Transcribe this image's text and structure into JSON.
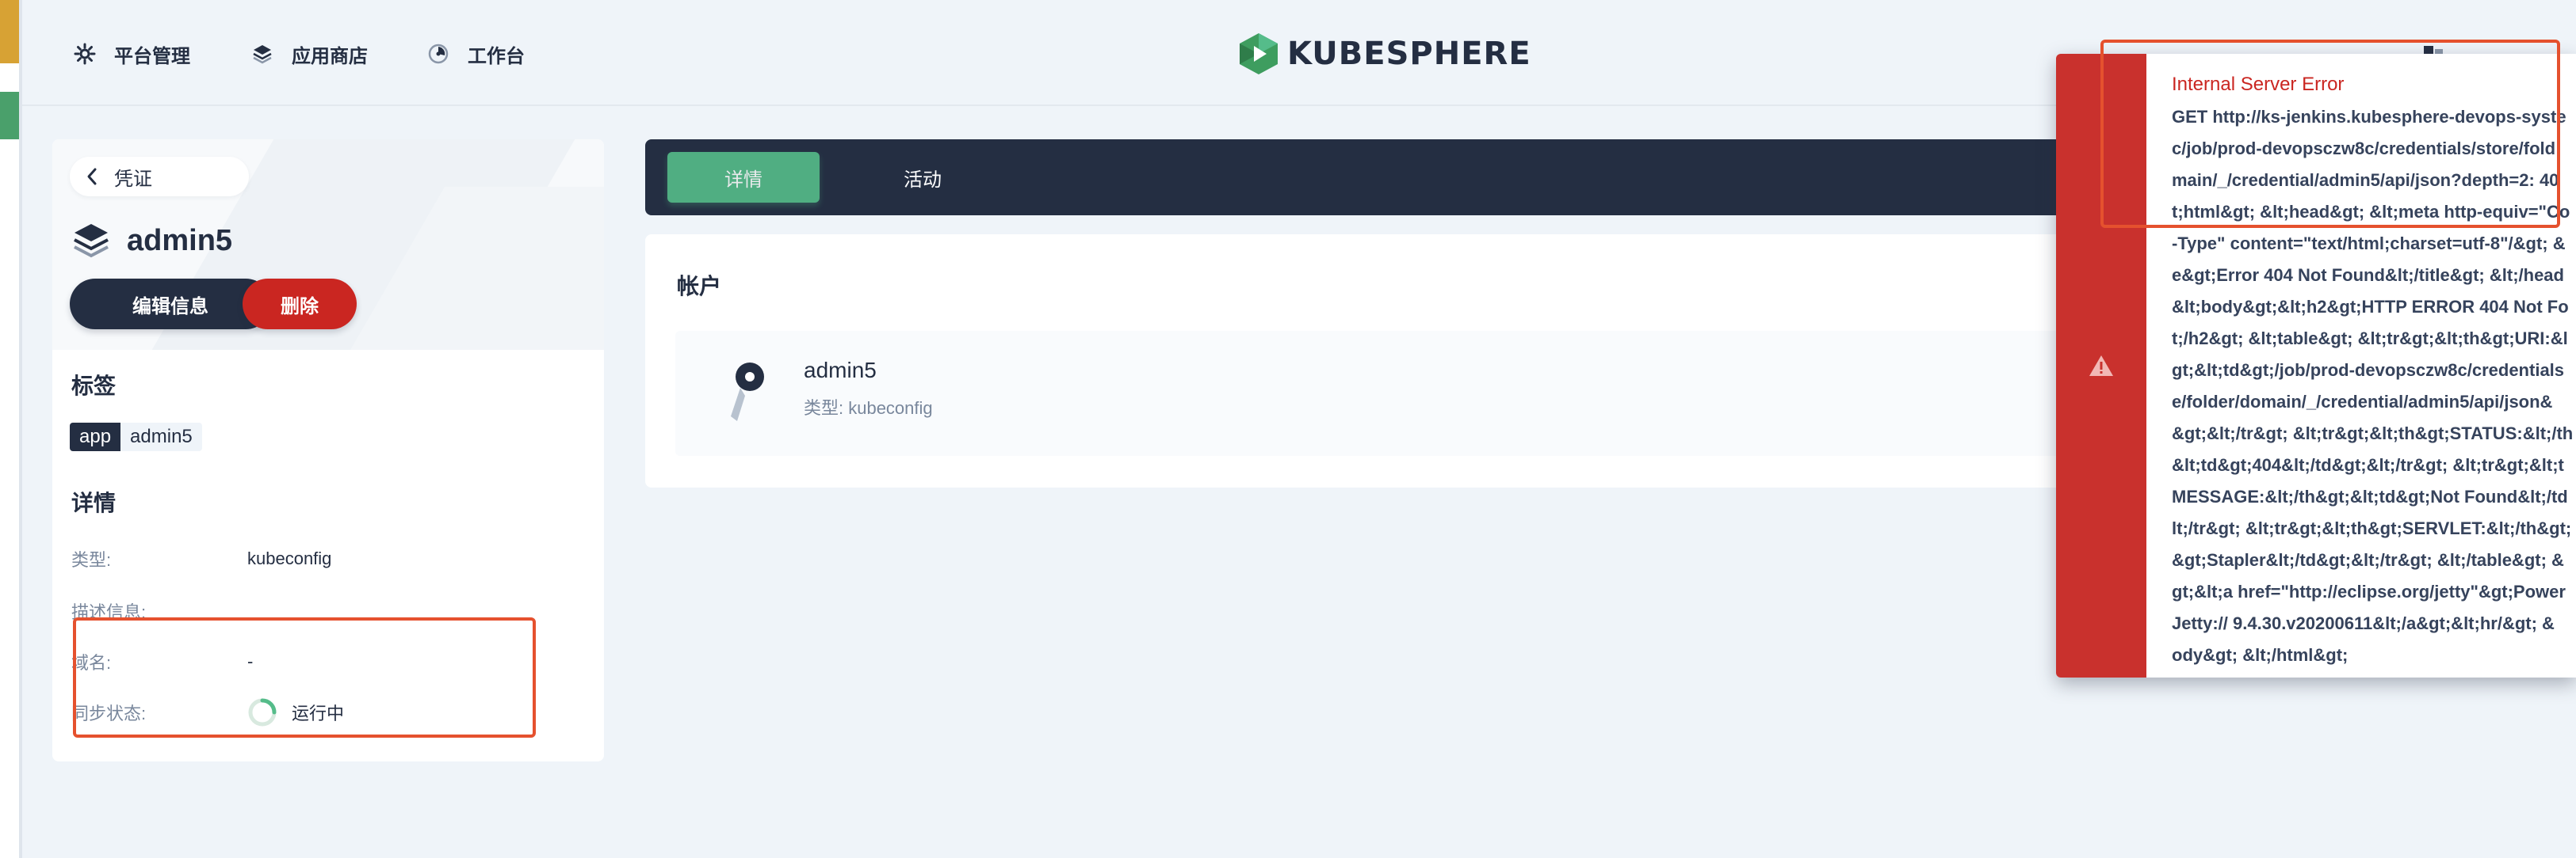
{
  "nav": {
    "platform": "平台管理",
    "appstore": "应用商店",
    "workbench": "工作台"
  },
  "logo": {
    "text": "KUBESPHERE"
  },
  "detail": {
    "back_label": "凭证",
    "name": "admin5",
    "edit_label": "编辑信息",
    "delete_label": "删除",
    "labels_title": "标签",
    "tag": {
      "key": "app",
      "value": "admin5"
    },
    "details_title": "详情",
    "rows": [
      {
        "key": "类型:",
        "value": "kubeconfig"
      },
      {
        "key": "描述信息:",
        "value": ""
      },
      {
        "key": "域名:",
        "value": "-"
      },
      {
        "key": "同步状态:",
        "value": "运行中"
      }
    ]
  },
  "tabs": [
    {
      "label": "详情",
      "active": true
    },
    {
      "label": "活动",
      "active": false
    }
  ],
  "account": {
    "title": "帐户",
    "name": "admin5",
    "type": "类型: kubeconfig"
  },
  "toast": {
    "title": "Internal Server Error",
    "lines": [
      "GET http://ks-jenkins.kubesphere-devops-syste",
      "c/job/prod-devopsczw8c/credentials/store/fold",
      "main/_/credential/admin5/api/json?depth=2: 40",
      "t;html&gt; &lt;head&gt; &lt;meta http-equiv=\"Co",
      "-Type\" content=\"text/html;charset=utf-8\"/&gt; &",
      "e&gt;Error 404 Not Found&lt;/title&gt; &lt;/head",
      "&lt;body&gt;&lt;h2&gt;HTTP ERROR 404 Not Fo",
      "t;/h2&gt; &lt;table&gt; &lt;tr&gt;&lt;th&gt;URI:&l",
      "gt;&lt;td&gt;/job/prod-devopsczw8c/credentials",
      "e/folder/domain/_/credential/admin5/api/json&",
      "&gt;&lt;/tr&gt; &lt;tr&gt;&lt;th&gt;STATUS:&lt;/th",
      "&lt;td&gt;404&lt;/td&gt;&lt;/tr&gt; &lt;tr&gt;&lt;t",
      "MESSAGE:&lt;/th&gt;&lt;td&gt;Not Found&lt;/td",
      "lt;/tr&gt; &lt;tr&gt;&lt;th&gt;SERVLET:&lt;/th&gt;",
      "&gt;Stapler&lt;/td&gt;&lt;/tr&gt; &lt;/table&gt; &",
      "gt;&lt;a href=\"http://eclipse.org/jetty\"&gt;Power",
      "Jetty:// 9.4.30.v20200611&lt;/a&gt;&lt;hr/&gt; &",
      "ody&gt; &lt;/html&gt;"
    ]
  },
  "colors": {
    "dark": "#242e42",
    "accent_green": "#55bc8a",
    "danger": "#ca2621",
    "annotation": "#e5512e"
  }
}
